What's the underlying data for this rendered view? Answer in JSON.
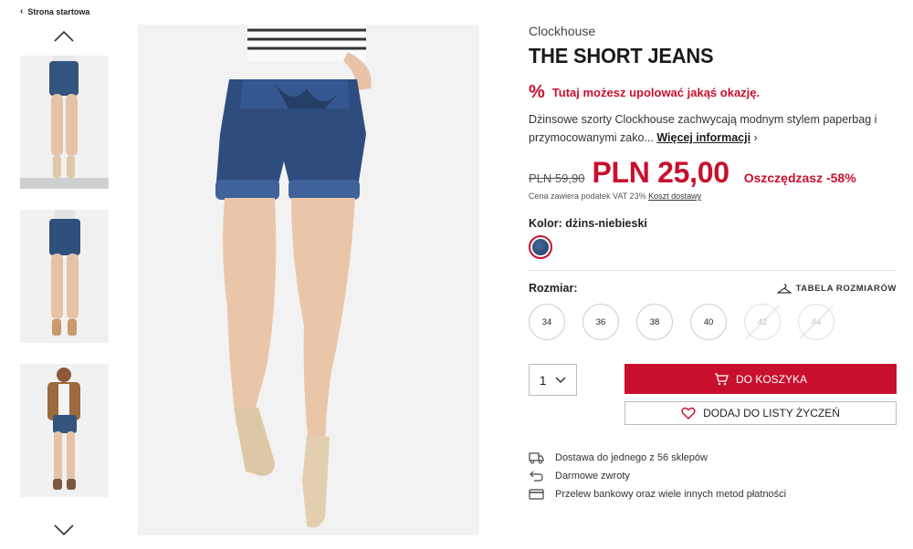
{
  "nav": {
    "back_label": "Strona startowa"
  },
  "product": {
    "brand": "Clockhouse",
    "title": "THE SHORT JEANS",
    "promo": "Tutaj możesz upolować jakąś okazję.",
    "description": "Dżinsowe szorty Clockhouse zachwycają modnym stylem paperbag i przymocowanymi zako...",
    "more_label": "Więcej informacji",
    "old_price": "PLN 59,90",
    "new_price": "PLN 25,00",
    "savings": "Oszczędzasz -58%",
    "vat_text": "Cena zawiera podatek VAT 23%",
    "shipping_link": "Koszt dostawy",
    "color_label": "Kolor: dżins-niebieski",
    "size_label": "Rozmiar:",
    "size_table_label": "TABELA ROZMIARÓW",
    "sizes": [
      {
        "label": "34",
        "available": true
      },
      {
        "label": "36",
        "available": true
      },
      {
        "label": "38",
        "available": true
      },
      {
        "label": "40",
        "available": true
      },
      {
        "label": "42",
        "available": false
      },
      {
        "label": "44",
        "available": false
      }
    ],
    "quantity": "1",
    "add_to_cart": "DO KOSZYKA",
    "add_to_wishlist": "DODAJ DO LISTY ŻYCZEŃ"
  },
  "benefits": [
    {
      "icon": "truck-icon",
      "text": "Dostawa do jednego z 56 sklepów"
    },
    {
      "icon": "return-icon",
      "text": "Darmowe zwroty"
    },
    {
      "icon": "card-icon",
      "text": "Przelew bankowy oraz wiele innych metod płatności"
    }
  ],
  "colors": {
    "accent": "#c8102e",
    "denim": "#2e4d7e"
  }
}
